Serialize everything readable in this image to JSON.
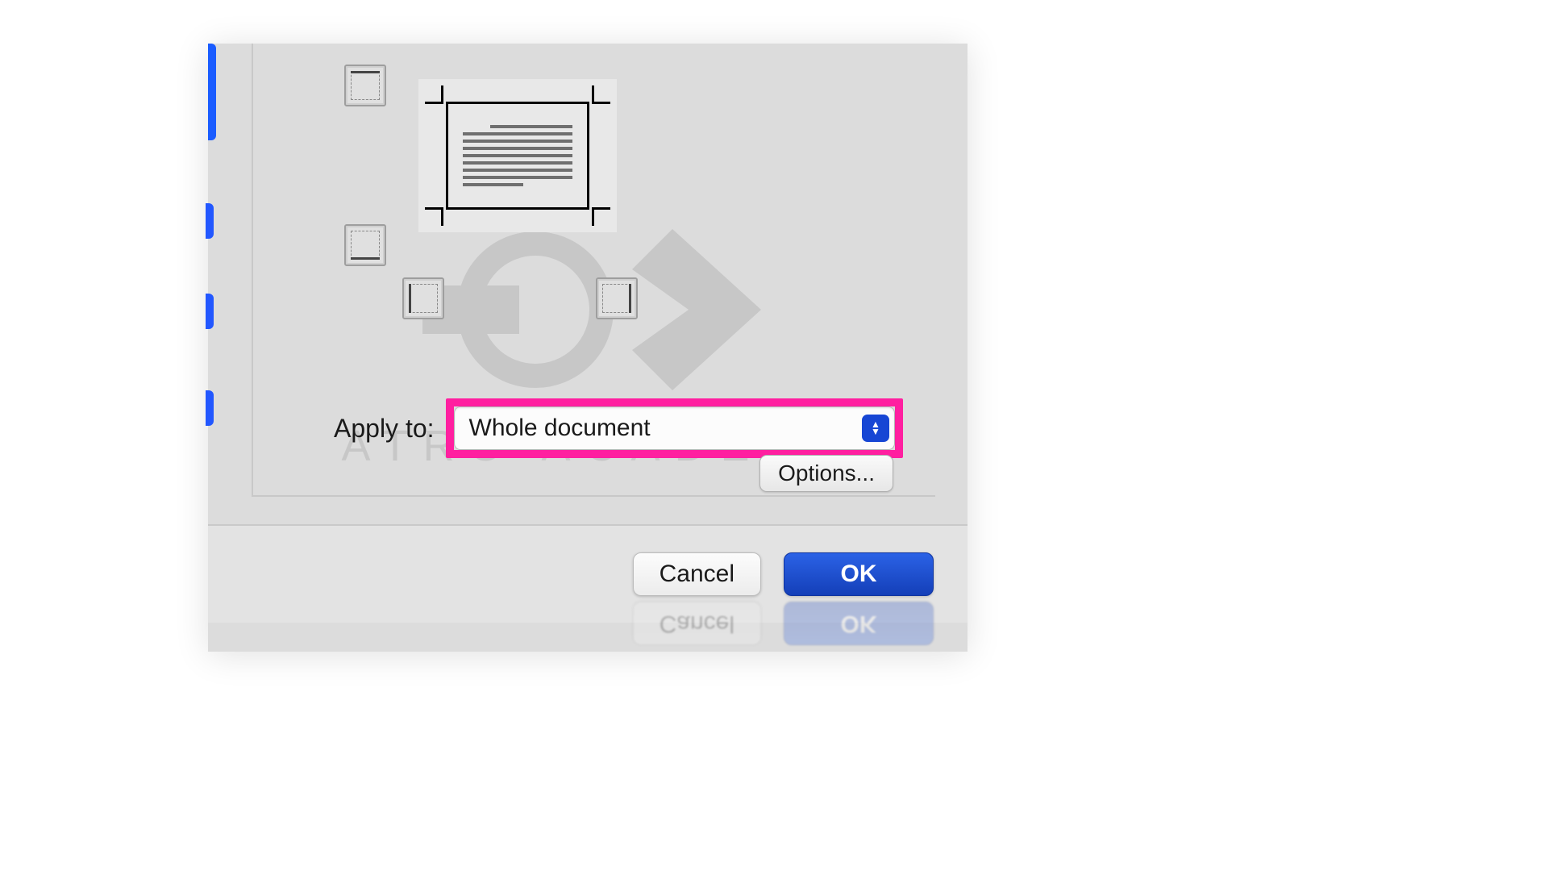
{
  "apply_to": {
    "label": "Apply to:",
    "value": "Whole document"
  },
  "buttons": {
    "options": "Options...",
    "cancel": "Cancel",
    "ok": "OK"
  },
  "watermark": "ATRO ACADEMY",
  "highlight_color": "#ff1fa0",
  "accent_blue": "#1746d4"
}
